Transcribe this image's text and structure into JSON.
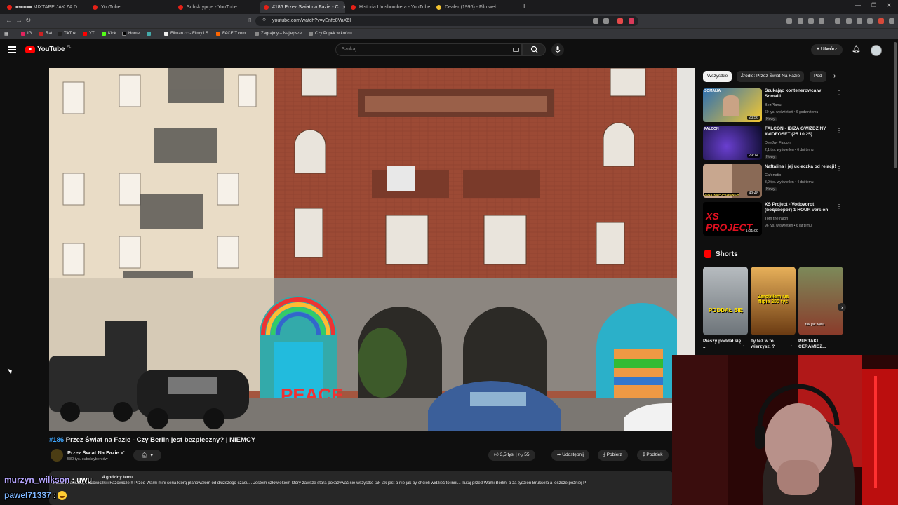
{
  "browser": {
    "tabs": [
      {
        "label": "■▪■■■■ MIXTAPE JAK ZA D",
        "icon": "record-icon",
        "left": 0
      },
      {
        "label": "YouTube"
      },
      {
        "label": "Subskrypcje - YouTube"
      },
      {
        "label": "#186 Przez Świat na Fazie - C"
      },
      {
        "label": "Historia Umsbombera - YouTube"
      },
      {
        "label": "Dealer (1996) - Filmweb"
      }
    ],
    "url": "youtube.com/watch?v=yEnfe8VaX6I",
    "bookmarks": [
      "IG",
      "Rat",
      "TikTok",
      "YT",
      "Kick",
      "Home",
      "",
      "Filman.cc - Filmy i S...",
      "FACEIT.com",
      "Zagrajmy – Najlepsze...",
      "Czy Popek w końcu..."
    ]
  },
  "header": {
    "logo_text": "YouTube",
    "country": "PL",
    "search_placeholder": "Szukaj",
    "create_label": "Utwórz"
  },
  "video": {
    "title_tag": "#186",
    "title_rest": "Przez Świat na Fazie - Czy Berlin jest bezpieczny? | NIEMCY",
    "channel": "Przez Świat Na Fazie",
    "subscribers": "580 tys. subskrybentów",
    "likes": "3,5 tys.",
    "dislikes": "55",
    "share_label": "Udostępnij",
    "download_label": "Pobierz",
    "thanks_label": "Podzięk",
    "desc_meta": "4 godziny temu",
    "desc_text": "Panie i Panowie, Fazowiczki i Fazowicze !! Przed Wami mini seria którą planowałem od dłuższego czasu... Jestem człowiekiem który zawsze stara pokazywać się wszystko tak jak jest a nie jak by chcieli widzieć to inni... Tutaj przed Wami Berlin, a za tydzień Bruksela a jeszcze później P"
  },
  "sidebar": {
    "chips": [
      "Wszystkie",
      "Źródło: Przez Świat Na Fazie",
      "Pod"
    ],
    "recommendations": [
      {
        "title": "Szukając kontenerowca w Somalii",
        "channel": "BezPlanu",
        "views": "60 tys. wyświetleń • 6 godzin temu",
        "badge": "Nowy",
        "duration": "23:56",
        "thumb_text": "SOMALIA"
      },
      {
        "title": "FALCON - IBIZA GWIŹDZINY #VIDEOSET (25.10.25)",
        "channel": "DeeJay Falcon",
        "views": "2,1 tys. wyświetleń • 6 dni temu",
        "badge": "Nowy",
        "duration": "29:14",
        "thumb_text": "FALCON"
      },
      {
        "title": "Naftalina i jej ucieczka od relacji!",
        "channel": "Cafonatix",
        "views": "3,9 tys. wyświetleń • 4 dni temu",
        "badge": "Nowy",
        "duration": "49:48",
        "thumb_text": "ZONATKA POPRZEDNICH"
      },
      {
        "title": "XS Project - Vodovorot (водоворот) 1 HOUR version",
        "channel": "Tom the raion",
        "views": "96 tys. wyświetleń • 6 lat temu",
        "badge": "",
        "duration": "1:01:00",
        "thumb_text": "XS PROJECT"
      }
    ],
    "shorts_label": "Shorts",
    "shorts": [
      {
        "caption": "Pieszy poddał się ...",
        "overlay": "PODDAŁ SIĘ"
      },
      {
        "caption": "Ty też w to wierzysz. ?",
        "overlay": "Zarobiłem Na flipie 200 tys"
      },
      {
        "caption": "PUSTAKI CERAMICZ...",
        "overlay": "tak jak wielu"
      }
    ]
  },
  "chat": [
    {
      "user": "murzyn_wilkson",
      "msg": "uwu"
    },
    {
      "user": "pawel71337",
      "msg": ":"
    }
  ],
  "colors": {
    "accent": "#ff0000",
    "background": "#0f0f0f",
    "link": "#3ea6ff"
  }
}
